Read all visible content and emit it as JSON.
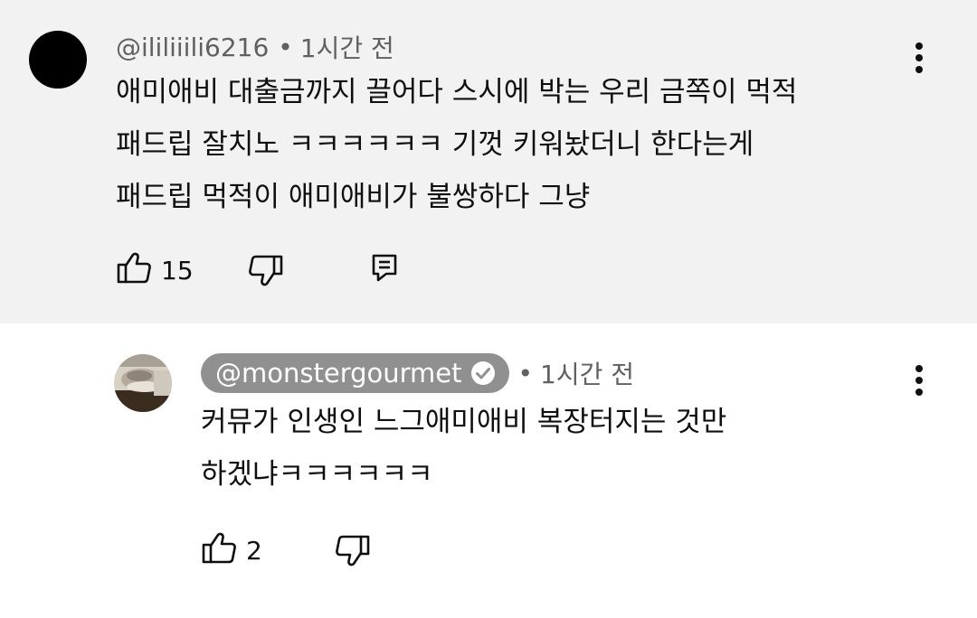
{
  "comment": {
    "author": "@ililiiili6216",
    "separator": "•",
    "time": "1시간 전",
    "lines": [
      "애미애비 대출금까지 끌어다 스시에 박는 우리 금쪽이 먹적",
      "패드립 잘치노 ㅋㅋㅋㅋㅋㅋ 기껏 키워놨더니 한다는게",
      "패드립 먹적이 애미애비가 불쌍하다 그냥"
    ],
    "like_count": "15",
    "icons": [
      "thumbs-up-icon",
      "thumbs-down-icon",
      "reply-icon",
      "more-vert-icon"
    ]
  },
  "reply": {
    "author": "@monstergourmet",
    "separator": "•",
    "time": "1시간 전",
    "lines": [
      "커뮤가 인생인 느그애미애비 복장터지는 것만",
      "하겠냐ㅋㅋㅋㅋㅋㅋ"
    ],
    "like_count": "2",
    "icons": [
      "thumbs-up-icon",
      "thumbs-down-icon",
      "verified-check-icon",
      "more-vert-icon"
    ]
  },
  "colors": {
    "highlight_bg": "#f2f2f2",
    "meta_text": "#606060",
    "chip_bg": "#909090"
  }
}
